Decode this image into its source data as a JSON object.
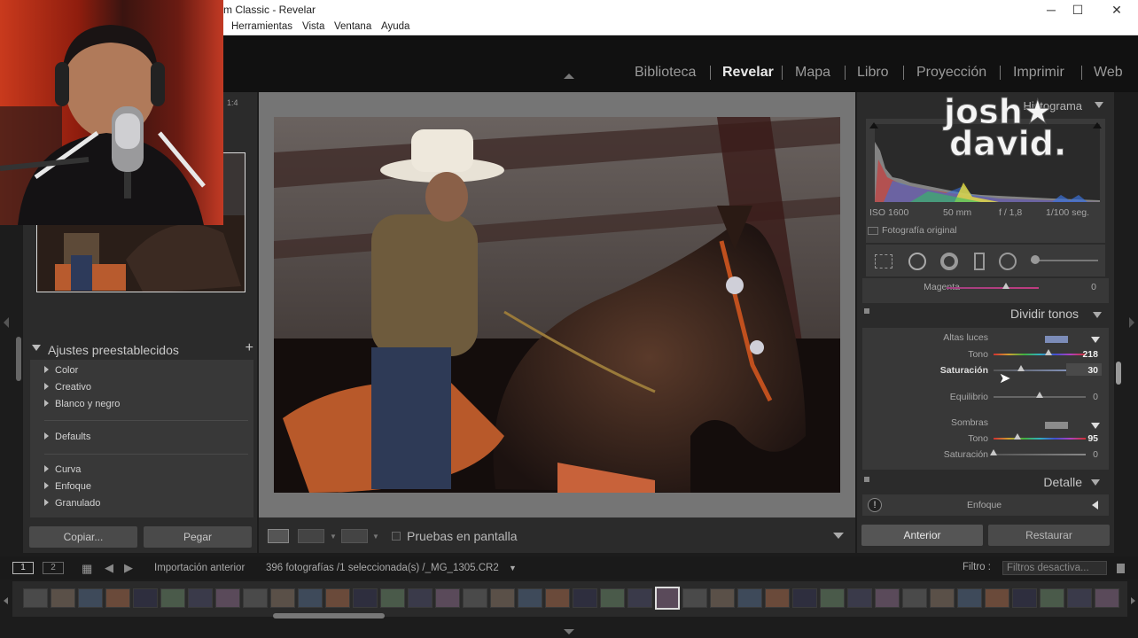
{
  "window": {
    "title": "m Classic - Revelar",
    "controls": [
      "─",
      "☐",
      "✕"
    ]
  },
  "menubar": [
    "Herramientas",
    "Vista",
    "Ventana",
    "Ayuda"
  ],
  "modules": {
    "items": [
      "Biblioteca",
      "Revelar",
      "Mapa",
      "Libro",
      "Proyección",
      "Imprimir",
      "Web"
    ],
    "active": "Revelar"
  },
  "navigator": {
    "zoom": "1:4"
  },
  "presets": {
    "title": "Ajustes preestablecidos",
    "add_icon": "+",
    "items": [
      "Color",
      "Creativo",
      "Blanco y negro",
      "Defaults",
      "Curva",
      "Enfoque",
      "Granulado"
    ]
  },
  "left_buttons": {
    "copy": "Copiar...",
    "paste": "Pegar"
  },
  "center_toolbar": {
    "soft_proofing": "Pruebas en pantalla"
  },
  "histogram": {
    "title": "Histograma",
    "iso": "ISO 1600",
    "focal": "50 mm",
    "aperture": "f / 1,8",
    "shutter": "1/100 seg.",
    "original_photo": "Fotografía original"
  },
  "watermark": {
    "line1": "josh★",
    "line2": "david."
  },
  "hsl": {
    "magenta_label": "Magenta",
    "magenta_value": "0"
  },
  "split_toning": {
    "title": "Dividir tonos",
    "highlights_label": "Altas luces",
    "highlights_color": "#7c8cb8",
    "highlights_hue_label": "Tono",
    "highlights_hue": "218",
    "highlights_hue_frac": 0.6,
    "highlights_sat_label": "Saturación",
    "highlights_sat": "30",
    "highlights_sat_frac": 0.3,
    "balance_label": "Equilibrio",
    "balance": "0",
    "balance_frac": 0.5,
    "shadows_label": "Sombras",
    "shadows_color": "#8c8c8c",
    "shadows_hue_label": "Tono",
    "shadows_hue": "95",
    "shadows_hue_frac": 0.26,
    "shadows_sat_label": "Saturación",
    "shadows_sat": "0",
    "shadows_sat_frac": 0.0
  },
  "detail": {
    "title": "Detalle",
    "sharpening": "Enfoque"
  },
  "right_buttons": {
    "previous": "Anterior",
    "reset": "Restaurar"
  },
  "filmstrip": {
    "source": "Importación anterior",
    "status": "396 fotografías /1 seleccionada(s) /_MG_1305.CR2",
    "filter_label": "Filtro :",
    "filter_value": "Filtros desactiva...",
    "view1": "1",
    "view2": "2"
  }
}
